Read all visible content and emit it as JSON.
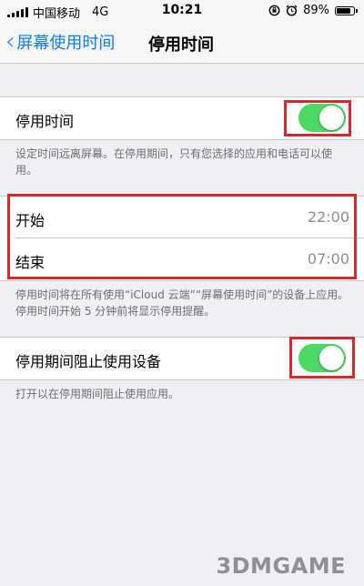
{
  "status_bar": {
    "carrier": "中国移动",
    "network": "4G",
    "time": "10:21",
    "battery_percent": "89%",
    "battery_level": 0.89
  },
  "nav": {
    "back_label": "屏幕使用时间",
    "title": "停用时间"
  },
  "downtime": {
    "label": "停用时间",
    "enabled": true,
    "description": "设定时间远离屏幕。在停用期间，只有您选择的应用和电话可以使用。"
  },
  "schedule": {
    "start_label": "开始",
    "start_value": "22:00",
    "end_label": "结束",
    "end_value": "07:00",
    "description": "停用时间将在所有使用“iCloud 云端”“屏幕使用时间”的设备上应用。停用时间开始 5 分钟前将显示停用提醒。"
  },
  "block": {
    "label": "停用期间阻止使用设备",
    "enabled": true,
    "description": "打开以在停用期间阻止使用应用。"
  },
  "watermark": "3DMGAME",
  "colors": {
    "toggle_on": "#4cd964",
    "link": "#0a7cff",
    "highlight": "#d42a2a"
  }
}
